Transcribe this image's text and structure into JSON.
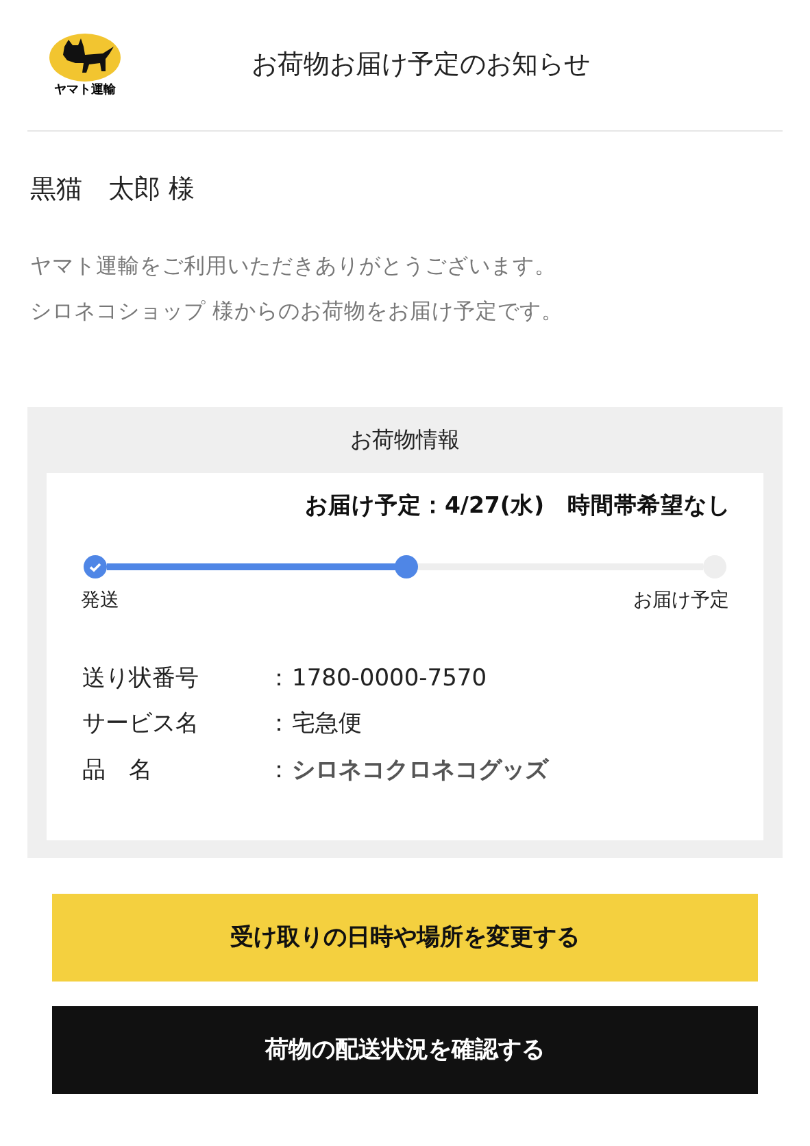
{
  "header": {
    "logo_text": "ヤマト運輸",
    "title": "お荷物お届け予定のお知らせ"
  },
  "recipient": "黒猫　太郎 様",
  "message": [
    "ヤマト運輸をご利用いただきありがとうございます。",
    "シロネコショップ 様からのお荷物をお届け予定です。"
  ],
  "info": {
    "title": "お荷物情報",
    "delivery": "お届け予定：4/27(水)　時間帯希望なし",
    "progress": {
      "level": 0.5,
      "start_label": "発送",
      "end_label": "お届け予定"
    },
    "details": [
      {
        "label": "送り状番号",
        "separator": "：",
        "value": "1780-0000-7570",
        "emphasis": false
      },
      {
        "label": "サービス名",
        "separator": "：",
        "value": "宅急便",
        "emphasis": false
      },
      {
        "label": "品　名",
        "separator": "：",
        "value": "シロネコクロネコグッズ",
        "emphasis": true
      }
    ]
  },
  "buttons": [
    {
      "label": "受け取りの日時や場所を変更する",
      "kind": "primary"
    },
    {
      "label": "荷物の配送状況を確認する",
      "kind": "dark"
    }
  ]
}
